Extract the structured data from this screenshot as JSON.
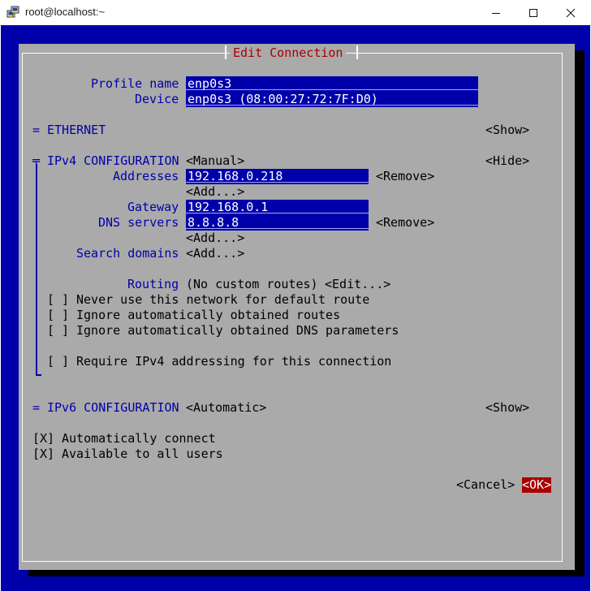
{
  "window": {
    "title": "root@localhost:~",
    "minimize_icon": "minimize-icon",
    "maximize_icon": "maximize-icon",
    "close_icon": "close-icon"
  },
  "dialog": {
    "title": "Edit Connection",
    "profile_name_label": "Profile name",
    "profile_name_value": "enp0s3",
    "device_label": "Device",
    "device_value": "enp0s3 (08:00:27:72:7F:D0)",
    "ethernet": {
      "marker": "=",
      "label": "ETHERNET",
      "toggle": "<Show>"
    },
    "ipv4": {
      "marker": "╤",
      "label": "IPv4 CONFIGURATION",
      "mode": "<Manual>",
      "toggle": "<Hide>",
      "addresses_label": "Addresses",
      "addresses": [
        "192.168.0.218"
      ],
      "remove_label": "<Remove>",
      "add_label": "<Add...>",
      "gateway_label": "Gateway",
      "gateway_value": "192.168.0.1",
      "dns_label": "DNS servers",
      "dns": [
        "8.8.8.8"
      ],
      "search_domains_label": "Search domains",
      "routing_label": "Routing",
      "routing_value": "(No custom routes)",
      "routing_edit": "<Edit...>",
      "options": [
        {
          "box": "[ ]",
          "label": "Never use this network for default route"
        },
        {
          "box": "[ ]",
          "label": "Ignore automatically obtained routes"
        },
        {
          "box": "[ ]",
          "label": "Ignore automatically obtained DNS parameters"
        }
      ],
      "require": {
        "box": "[ ]",
        "label": "Require IPv4 addressing for this connection"
      }
    },
    "ipv6": {
      "marker": "=",
      "label": "IPv6 CONFIGURATION",
      "mode": "<Automatic>",
      "toggle": "<Show>"
    },
    "auto_connect": {
      "box": "[X]",
      "label": "Automatically connect"
    },
    "all_users": {
      "box": "[X]",
      "label": "Available to all users"
    },
    "cancel_label": "<Cancel>",
    "ok_label": "<OK>"
  },
  "colors": {
    "terminal_bg": "#0000aa",
    "dialog_bg": "#aaaaaa",
    "field_bg": "#0000aa",
    "label": "#0000aa",
    "title": "#aa0000",
    "ok_bg": "#aa0000"
  }
}
